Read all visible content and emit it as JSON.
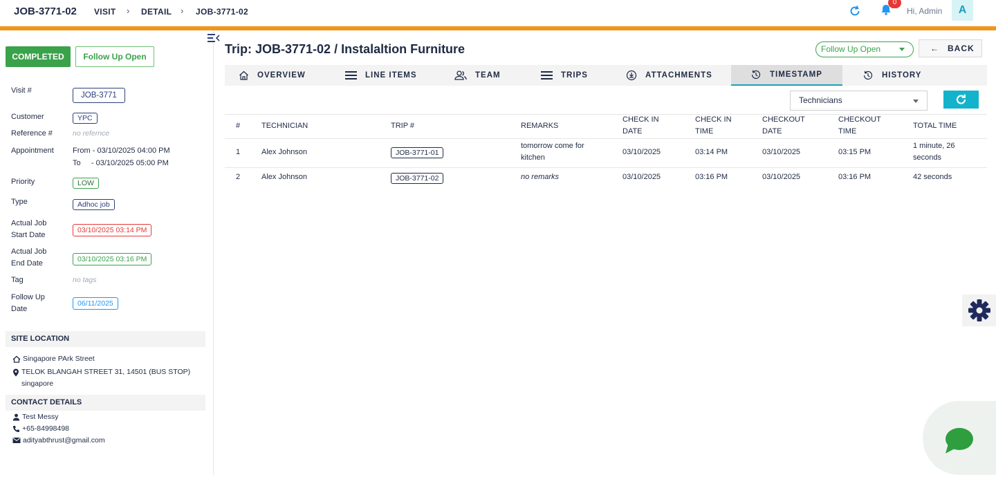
{
  "header": {
    "job_title": "JOB-3771-02",
    "breadcrumb": [
      "VISIT",
      "DETAIL",
      "JOB-3771-02"
    ],
    "notifications_count": "0",
    "greeting": "Hi, Admin",
    "avatar_initial": "A"
  },
  "sidebar": {
    "status_completed": "COMPLETED",
    "status_followup": "Follow Up Open",
    "fields": {
      "visit_label": "Visit #",
      "visit_value": "JOB-3771",
      "customer_label": "Customer",
      "customer_value": "YPC",
      "reference_label": "Reference #",
      "reference_value": "no refernce",
      "appointment_label": "Appointment",
      "appointment_from": "From - 03/10/2025 04:00 PM",
      "appointment_to": "To     - 03/10/2025 05:00 PM",
      "priority_label": "Priority",
      "priority_value": "LOW",
      "type_label": "Type",
      "type_value": "Adhoc job",
      "actual_start_label_1": "Actual Job",
      "actual_start_label_2": "Start Date",
      "actual_start_value": "03/10/2025 03:14 PM",
      "actual_end_label_1": "Actual Job",
      "actual_end_label_2": "End Date",
      "actual_end_value": "03/10/2025 03:16 PM",
      "tag_label": "Tag",
      "tag_value": "no tags",
      "followup_label_1": "Follow Up",
      "followup_label_2": "Date",
      "followup_value": "06/11/2025"
    },
    "site_location": {
      "heading": "SITE LOCATION",
      "name": "Singapore PArk Street",
      "address_1": "TELOK BLANGAH STREET 31, 14501 (BUS STOP)",
      "address_2": "singapore"
    },
    "contact": {
      "heading": "CONTACT DETAILS",
      "name": "Test Messy",
      "phone": "+65-84998498",
      "email": "adityabthrust@gmail.com"
    }
  },
  "main": {
    "title": "Trip: JOB-3771-02 / Instalaltion Furniture",
    "status_select": "Follow Up Open",
    "back_label": "BACK",
    "tabs": [
      {
        "label": "OVERVIEW",
        "icon": "home-icon"
      },
      {
        "label": "LINE ITEMS",
        "icon": "list-icon"
      },
      {
        "label": "TEAM",
        "icon": "team-icon"
      },
      {
        "label": "TRIPS",
        "icon": "list-icon"
      },
      {
        "label": "ATTACHMENTS",
        "icon": "attachment-icon"
      },
      {
        "label": "TIMESTAMP",
        "icon": "history-icon",
        "active": true
      },
      {
        "label": "HISTORY",
        "icon": "history-icon"
      }
    ],
    "filter_select": "Technicians",
    "table": {
      "headers": {
        "num": "#",
        "technician": "TECHNICIAN",
        "trip": "TRIP #",
        "remarks": "REMARKS",
        "checkin_date_1": "CHECK IN",
        "checkin_date_2": "DATE",
        "checkin_time_1": "CHECK IN",
        "checkin_time_2": "TIME",
        "checkout_date_1": "CHECKOUT",
        "checkout_date_2": "DATE",
        "checkout_time_1": "CHECKOUT",
        "checkout_time_2": "TIME",
        "total": "TOTAL TIME"
      },
      "rows": [
        {
          "num": "1",
          "technician": "Alex Johnson",
          "trip": "JOB-3771-01",
          "remarks_1": "tomorrow come for",
          "remarks_2": "kitchen",
          "checkin_date": "03/10/2025",
          "checkin_time": "03:14 PM",
          "checkout_date": "03/10/2025",
          "checkout_time": "03:15 PM",
          "total_1": "1 minute, 26",
          "total_2": "seconds"
        },
        {
          "num": "2",
          "technician": "Alex Johnson",
          "trip": "JOB-3771-02",
          "remarks": "no remarks",
          "checkin_date": "03/10/2025",
          "checkin_time": "03:16 PM",
          "checkout_date": "03/10/2025",
          "checkout_time": "03:16 PM",
          "total": "42 seconds"
        }
      ]
    }
  },
  "colors": {
    "accent_orange": "#f0951e",
    "success_green": "#3aa24a",
    "danger_red": "#e53935",
    "info_blue": "#2196f3",
    "teal": "#14b3cc",
    "text_navy": "#1f2a44"
  }
}
